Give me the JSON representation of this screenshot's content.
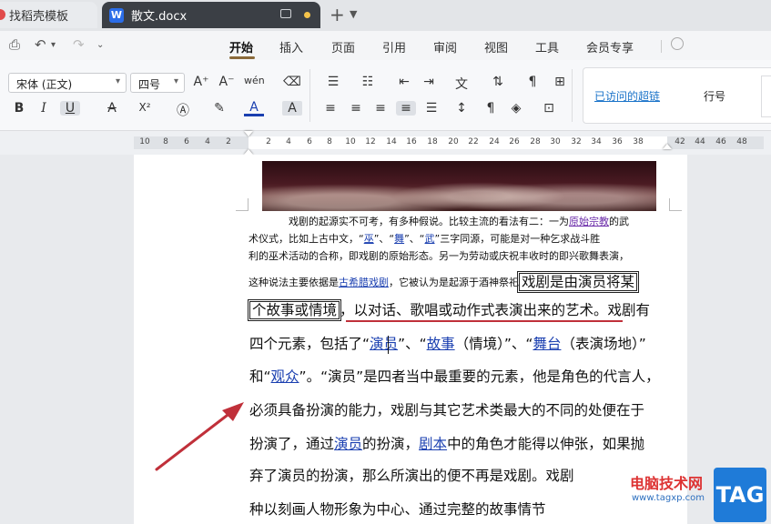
{
  "tabs": [
    {
      "label": "找稻壳模板"
    },
    {
      "label": "散文.docx",
      "icon": "W"
    }
  ],
  "menu": {
    "items": [
      "开始",
      "插入",
      "页面",
      "引用",
      "审阅",
      "视图",
      "工具",
      "会员专享"
    ],
    "active": "开始"
  },
  "ribbon": {
    "font_name": "宋体 (正文)",
    "font_size": "四号",
    "style_visited_link": "已访问的超链",
    "style_line_number": "行号",
    "icons": {
      "bold": "B",
      "italic": "I",
      "underline": "U",
      "strike": "A",
      "superscript": "X²",
      "grow": "A⁺",
      "shrink": "A⁻",
      "pinyin": "wén",
      "clear": "⌫"
    }
  },
  "ruler": {
    "left_ticks": [
      "10",
      "8",
      "6",
      "4",
      "2"
    ],
    "main_ticks": [
      "2",
      "4",
      "6",
      "8",
      "10",
      "12",
      "14",
      "16",
      "18",
      "20",
      "22",
      "24",
      "26",
      "28",
      "30",
      "32",
      "34",
      "36",
      "38"
    ],
    "right_ticks": [
      "42",
      "44",
      "46",
      "48"
    ]
  },
  "document": {
    "small_lines": [
      {
        "a": "戏剧的起源实不可考，有多种假说。比较主流的看法有二：一为",
        "link": "原始宗教",
        "b": "的武"
      },
      {
        "a": "术仪式，比如上古中文，“",
        "l1": "巫",
        "m1": "”、“",
        "l2": "舞",
        "m2": "”、“",
        "l3": "武",
        "b": "”三字同源，可能是对一种乞求战斗胜"
      },
      {
        "a": "利的巫术活动的合称，即戏剧的原始形态。另一为劳动或庆祝丰收时的即兴歌舞表演，"
      },
      {
        "a": "这种说法主要依据是",
        "link": "古希腊戏剧",
        "b": "，它被认为是起源于酒神祭祀",
        "box": "戏剧是由演员将某"
      }
    ],
    "large_lines": [
      {
        "box": "个故事或情境",
        "a": "，以对话、歌唱或动作式表演出来的艺术。戏剧有"
      },
      {
        "a": "四个元素，包括了“",
        "l1": "演员",
        "m1": "”、“",
        "l2": "故事",
        "m2": "（情境）”、“",
        "l3": "舞台",
        "b": "（表演场地）”"
      },
      {
        "a": "和“",
        "l1": "观众",
        "b": "”。“演员”是四者当中最重要的元素，他是角色的代言人，"
      },
      {
        "a": "必须具备扮演的能力，戏剧与其它艺术类最大的不同的处便在于"
      },
      {
        "a": "扮演了，通过",
        "l1": "演员",
        "m1": "的扮演，",
        "l2": "剧本",
        "b": "中的角色才能得以伸张，如果抛"
      },
      {
        "a": "弃了演员的扮演，那么所演出的便不再是戏剧。戏剧"
      },
      {
        "a": "种以刻画人物形象为中心、通过完整的故事情节"
      }
    ]
  },
  "watermark": {
    "site_name": "电脑技术网",
    "url": "www.tagxp.com",
    "tag": "TAG"
  },
  "colors": {
    "link": "#1a3fb0",
    "visited_link": "#6a2aa8",
    "red_arrow": "#c0303a",
    "active_tab": "#3b3f45",
    "watermark_tag": "#1f7bd8"
  }
}
